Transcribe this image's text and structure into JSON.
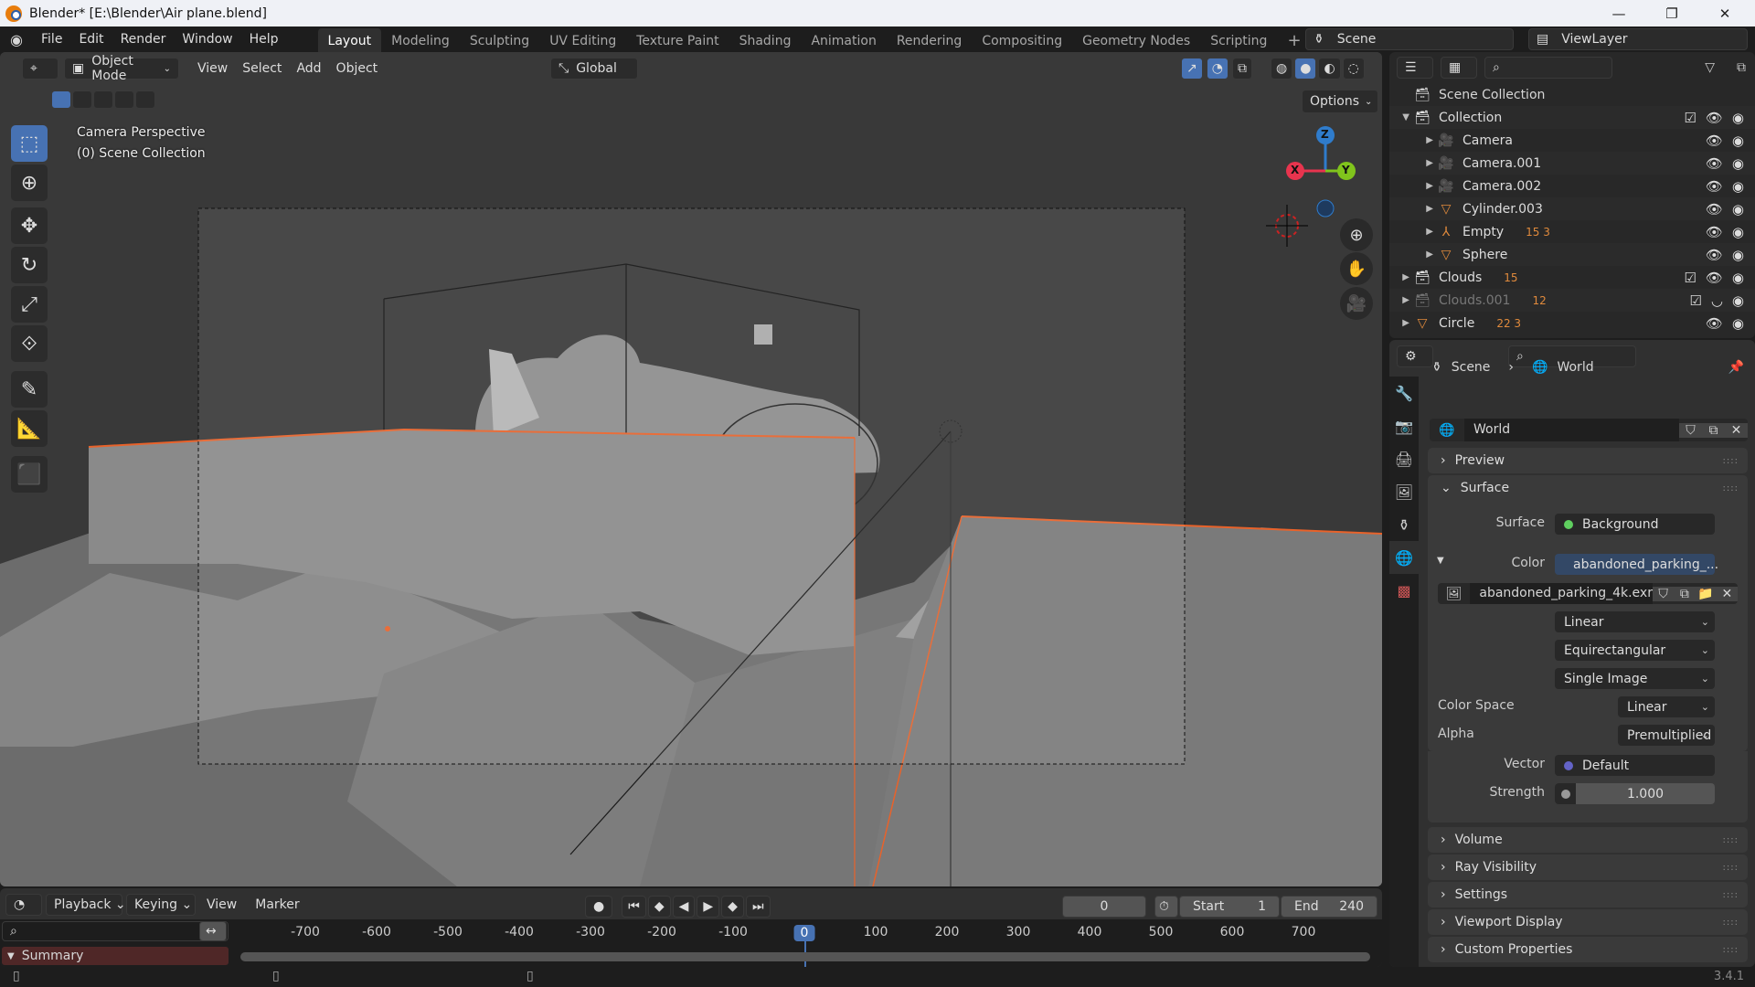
{
  "window": {
    "title": "Blender* [E:\\Blender\\Air plane.blend]",
    "minimize": "—",
    "maximize": "❐",
    "close": "✕"
  },
  "menubar": {
    "items": [
      "File",
      "Edit",
      "Render",
      "Window",
      "Help"
    ],
    "workspaces": [
      "Layout",
      "Modeling",
      "Sculpting",
      "UV Editing",
      "Texture Paint",
      "Shading",
      "Animation",
      "Rendering",
      "Compositing",
      "Geometry Nodes",
      "Scripting"
    ],
    "active_workspace": "Layout",
    "add": "+",
    "scene": "Scene",
    "view_layer": "ViewLayer"
  },
  "viewport": {
    "mode": "Object Mode",
    "menus": [
      "View",
      "Select",
      "Add",
      "Object"
    ],
    "orientation": "Global",
    "options": "Options",
    "overlay_title": "Camera Perspective",
    "overlay_collection": "(0) Scene Collection",
    "gizmo": {
      "x": "X",
      "y": "Y",
      "z": "Z"
    },
    "colors": {
      "selected_outline": "#e8622a",
      "gizmo_x": "#e8344e",
      "gizmo_y": "#80c41c",
      "gizmo_z": "#2f7ccc",
      "accent": "#4772b3"
    }
  },
  "outliner": {
    "root": "Scene Collection",
    "rows": [
      {
        "name": "Collection",
        "type": "collection",
        "expanded": true,
        "indent": 0,
        "checkbox": true
      },
      {
        "name": "Camera",
        "type": "camera",
        "indent": 1,
        "extra": ""
      },
      {
        "name": "Camera.001",
        "type": "camera",
        "indent": 1,
        "extra": ""
      },
      {
        "name": "Camera.002",
        "type": "camera",
        "indent": 1,
        "extra": ""
      },
      {
        "name": "Cylinder.003",
        "type": "mesh",
        "indent": 1,
        "extra": ""
      },
      {
        "name": "Empty",
        "type": "empty",
        "indent": 1,
        "extra": "15 3"
      },
      {
        "name": "Sphere",
        "type": "mesh",
        "indent": 1,
        "extra": ""
      },
      {
        "name": "Clouds",
        "type": "collection",
        "indent": 0,
        "checkbox": true,
        "extra": "15"
      },
      {
        "name": "Clouds.001",
        "type": "collection",
        "indent": 0,
        "checkbox": true,
        "hidden": true,
        "extra": "12"
      },
      {
        "name": "Circle",
        "type": "mesh",
        "indent": 0,
        "extra": "22 3"
      }
    ]
  },
  "properties": {
    "breadcrumb": [
      "Scene",
      "World"
    ],
    "world_name": "World",
    "panels": {
      "preview": "Preview",
      "surface": "Surface",
      "volume": "Volume",
      "ray_visibility": "Ray Visibility",
      "settings": "Settings",
      "viewport_display": "Viewport Display",
      "custom_properties": "Custom Properties"
    },
    "surface": {
      "surface_label": "Surface",
      "surface_value": "Background",
      "color_label": "Color",
      "color_value": "abandoned_parking_...",
      "image_name": "abandoned_parking_4k.exr",
      "interpolation": "Linear",
      "projection": "Equirectangular",
      "source": "Single Image",
      "color_space_label": "Color Space",
      "color_space": "Linear",
      "alpha_label": "Alpha",
      "alpha": "Premultiplied",
      "vector_label": "Vector",
      "vector": "Default",
      "strength_label": "Strength",
      "strength": "1.000"
    }
  },
  "timeline": {
    "menus": [
      "Playback",
      "Keying",
      "View",
      "Marker"
    ],
    "current_frame": "0",
    "start_label": "Start",
    "start": "1",
    "end_label": "End",
    "end": "240",
    "ruler": [
      "-700",
      "-600",
      "-500",
      "-400",
      "-300",
      "-200",
      "-100",
      "0",
      "100",
      "200",
      "300",
      "400",
      "500",
      "600",
      "700"
    ],
    "summary": "Summary"
  },
  "status": {
    "version": "3.4.1"
  }
}
